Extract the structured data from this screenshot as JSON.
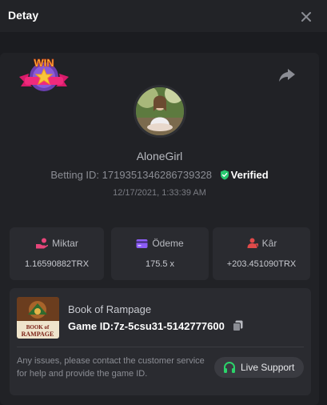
{
  "header": {
    "title": "Detay"
  },
  "bet": {
    "badge_text": "WIN",
    "username": "AloneGirl",
    "betting_id_label": "Betting ID:",
    "betting_id": "1719351346286739328",
    "verified_label": "Verified",
    "datetime": "12/17/2021, 1:33:39 AM"
  },
  "stats": {
    "amount": {
      "label": "Miktar",
      "value": "1.16590882TRX"
    },
    "payout": {
      "label": "Ödeme",
      "value": "175.5 x"
    },
    "profit": {
      "label": "Kâr",
      "value": "+203.451090TRX"
    }
  },
  "game": {
    "name": "Book of Rampage",
    "id_label": "Game ID:",
    "id": "7z-5csu31-5142777600",
    "thumb_text_line1": "BOOK of",
    "thumb_text_line2": "RAMPAGE",
    "help_text": "Any issues, please contact the customer service for help and provide the game ID.",
    "support_label": "Live Support"
  },
  "colors": {
    "background": "#1b1c20",
    "card": "#2a2b30",
    "verified_green": "#28c76f",
    "amount_icon": "#e8457a",
    "payout_icon": "#8c5cf6",
    "profit_icon": "#e04a4a",
    "support_icon": "#2bd46a"
  },
  "icons": [
    "close-icon",
    "share-icon",
    "verified-shield-icon",
    "wallet-hand-icon",
    "card-icon",
    "profit-person-icon",
    "copy-icon",
    "headset-icon"
  ]
}
